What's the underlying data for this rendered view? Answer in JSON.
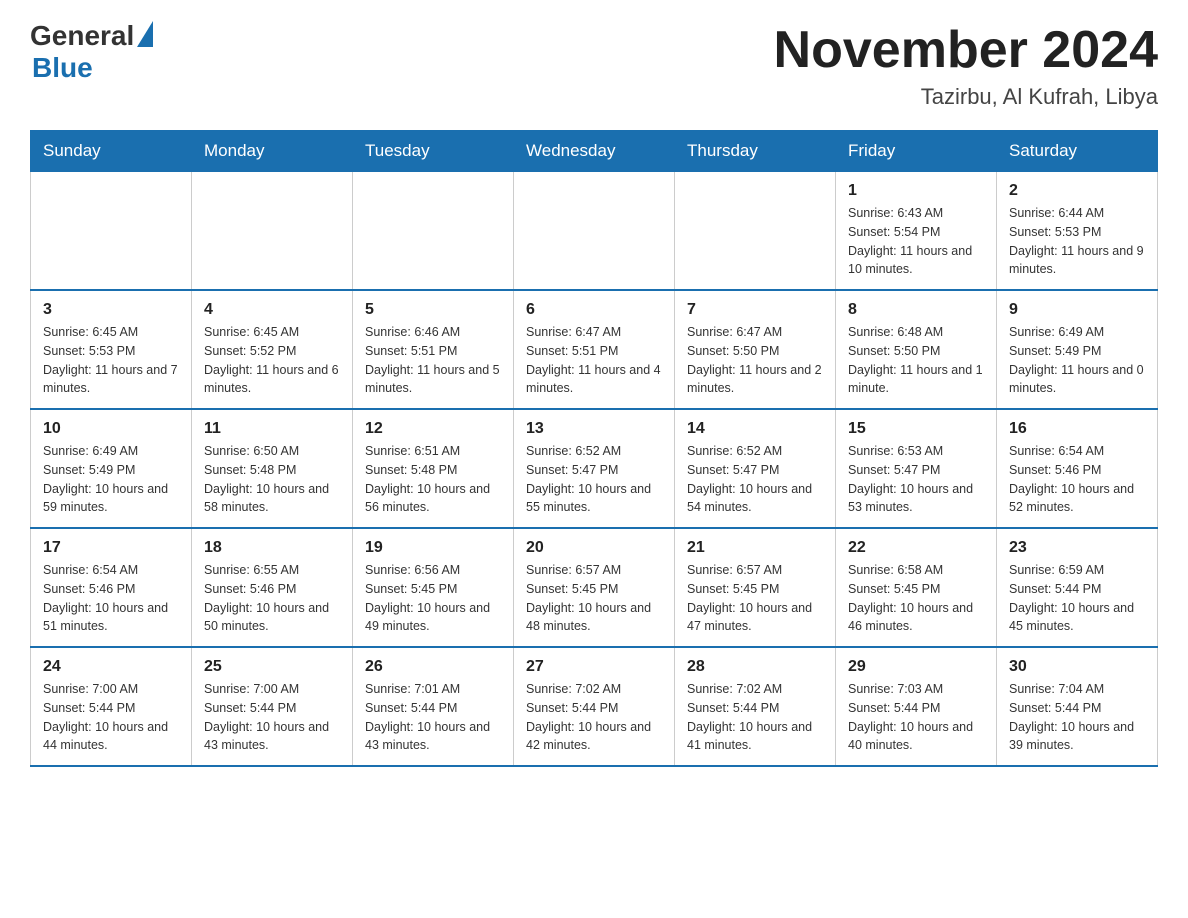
{
  "header": {
    "logo_general": "General",
    "logo_blue": "Blue",
    "month_title": "November 2024",
    "location": "Tazirbu, Al Kufrah, Libya"
  },
  "days_of_week": [
    "Sunday",
    "Monday",
    "Tuesday",
    "Wednesday",
    "Thursday",
    "Friday",
    "Saturday"
  ],
  "weeks": [
    [
      {
        "day": "",
        "info": ""
      },
      {
        "day": "",
        "info": ""
      },
      {
        "day": "",
        "info": ""
      },
      {
        "day": "",
        "info": ""
      },
      {
        "day": "",
        "info": ""
      },
      {
        "day": "1",
        "info": "Sunrise: 6:43 AM\nSunset: 5:54 PM\nDaylight: 11 hours and 10 minutes."
      },
      {
        "day": "2",
        "info": "Sunrise: 6:44 AM\nSunset: 5:53 PM\nDaylight: 11 hours and 9 minutes."
      }
    ],
    [
      {
        "day": "3",
        "info": "Sunrise: 6:45 AM\nSunset: 5:53 PM\nDaylight: 11 hours and 7 minutes."
      },
      {
        "day": "4",
        "info": "Sunrise: 6:45 AM\nSunset: 5:52 PM\nDaylight: 11 hours and 6 minutes."
      },
      {
        "day": "5",
        "info": "Sunrise: 6:46 AM\nSunset: 5:51 PM\nDaylight: 11 hours and 5 minutes."
      },
      {
        "day": "6",
        "info": "Sunrise: 6:47 AM\nSunset: 5:51 PM\nDaylight: 11 hours and 4 minutes."
      },
      {
        "day": "7",
        "info": "Sunrise: 6:47 AM\nSunset: 5:50 PM\nDaylight: 11 hours and 2 minutes."
      },
      {
        "day": "8",
        "info": "Sunrise: 6:48 AM\nSunset: 5:50 PM\nDaylight: 11 hours and 1 minute."
      },
      {
        "day": "9",
        "info": "Sunrise: 6:49 AM\nSunset: 5:49 PM\nDaylight: 11 hours and 0 minutes."
      }
    ],
    [
      {
        "day": "10",
        "info": "Sunrise: 6:49 AM\nSunset: 5:49 PM\nDaylight: 10 hours and 59 minutes."
      },
      {
        "day": "11",
        "info": "Sunrise: 6:50 AM\nSunset: 5:48 PM\nDaylight: 10 hours and 58 minutes."
      },
      {
        "day": "12",
        "info": "Sunrise: 6:51 AM\nSunset: 5:48 PM\nDaylight: 10 hours and 56 minutes."
      },
      {
        "day": "13",
        "info": "Sunrise: 6:52 AM\nSunset: 5:47 PM\nDaylight: 10 hours and 55 minutes."
      },
      {
        "day": "14",
        "info": "Sunrise: 6:52 AM\nSunset: 5:47 PM\nDaylight: 10 hours and 54 minutes."
      },
      {
        "day": "15",
        "info": "Sunrise: 6:53 AM\nSunset: 5:47 PM\nDaylight: 10 hours and 53 minutes."
      },
      {
        "day": "16",
        "info": "Sunrise: 6:54 AM\nSunset: 5:46 PM\nDaylight: 10 hours and 52 minutes."
      }
    ],
    [
      {
        "day": "17",
        "info": "Sunrise: 6:54 AM\nSunset: 5:46 PM\nDaylight: 10 hours and 51 minutes."
      },
      {
        "day": "18",
        "info": "Sunrise: 6:55 AM\nSunset: 5:46 PM\nDaylight: 10 hours and 50 minutes."
      },
      {
        "day": "19",
        "info": "Sunrise: 6:56 AM\nSunset: 5:45 PM\nDaylight: 10 hours and 49 minutes."
      },
      {
        "day": "20",
        "info": "Sunrise: 6:57 AM\nSunset: 5:45 PM\nDaylight: 10 hours and 48 minutes."
      },
      {
        "day": "21",
        "info": "Sunrise: 6:57 AM\nSunset: 5:45 PM\nDaylight: 10 hours and 47 minutes."
      },
      {
        "day": "22",
        "info": "Sunrise: 6:58 AM\nSunset: 5:45 PM\nDaylight: 10 hours and 46 minutes."
      },
      {
        "day": "23",
        "info": "Sunrise: 6:59 AM\nSunset: 5:44 PM\nDaylight: 10 hours and 45 minutes."
      }
    ],
    [
      {
        "day": "24",
        "info": "Sunrise: 7:00 AM\nSunset: 5:44 PM\nDaylight: 10 hours and 44 minutes."
      },
      {
        "day": "25",
        "info": "Sunrise: 7:00 AM\nSunset: 5:44 PM\nDaylight: 10 hours and 43 minutes."
      },
      {
        "day": "26",
        "info": "Sunrise: 7:01 AM\nSunset: 5:44 PM\nDaylight: 10 hours and 43 minutes."
      },
      {
        "day": "27",
        "info": "Sunrise: 7:02 AM\nSunset: 5:44 PM\nDaylight: 10 hours and 42 minutes."
      },
      {
        "day": "28",
        "info": "Sunrise: 7:02 AM\nSunset: 5:44 PM\nDaylight: 10 hours and 41 minutes."
      },
      {
        "day": "29",
        "info": "Sunrise: 7:03 AM\nSunset: 5:44 PM\nDaylight: 10 hours and 40 minutes."
      },
      {
        "day": "30",
        "info": "Sunrise: 7:04 AM\nSunset: 5:44 PM\nDaylight: 10 hours and 39 minutes."
      }
    ]
  ]
}
